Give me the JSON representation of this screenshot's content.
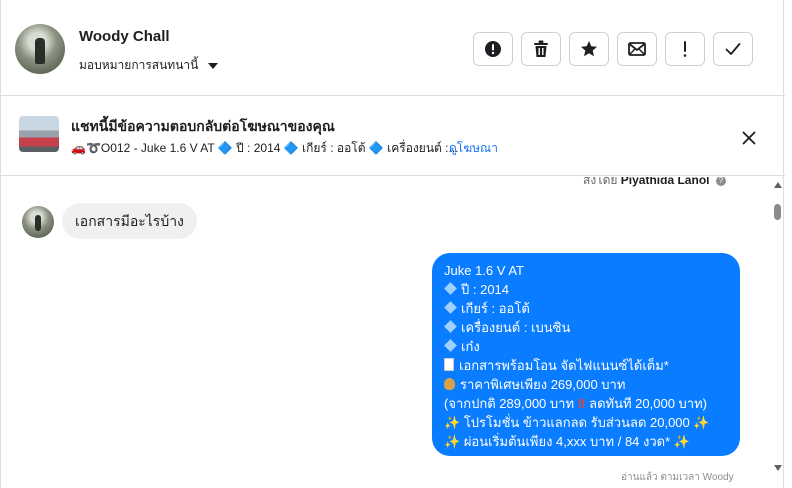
{
  "header": {
    "name": "Woody Chall",
    "assign_label": "มอบหมายการสนทนานี้",
    "actions": [
      {
        "icon": "alert-circle-icon",
        "name": "mark-spam-button"
      },
      {
        "icon": "trash-icon",
        "name": "delete-button"
      },
      {
        "icon": "star-icon",
        "name": "star-button"
      },
      {
        "icon": "envelope-icon",
        "name": "mark-unread-button"
      },
      {
        "icon": "exclamation-icon",
        "name": "follow-up-button"
      },
      {
        "icon": "check-icon",
        "name": "mark-done-button"
      }
    ]
  },
  "banner": {
    "title": "แชทนี้มีข้อความตอบกลับต่อโฆษณาของคุณ",
    "subtitle": "🚗➰O012 - Juke 1.6 V AT 🔷 ปี : 2014 🔷 เกียร์ : ออโต้ 🔷 เครื่องยนต์ :...",
    "link": "ดูโฆษณา"
  },
  "chat": {
    "sent_by_prefix": "ส่งโดย",
    "sent_by_name": "Piyathida Lanol",
    "incoming_message": "เอกสารมีอะไรบ้าง",
    "outgoing_lines": {
      "l1": "Juke 1.6 V AT",
      "l2": "ปี : 2014",
      "l3": "เกียร์ : ออโต้",
      "l4": "เครื่องยนต์ : เบนซิน",
      "l5": "เก๋ง",
      "l6": "เอกสารพร้อมโอน จัดไฟแนนซ์ได้เต็ม*",
      "l7": "ราคาพิเศษเพียง 269,000 บาท",
      "l8a": "(จากปกติ 289,000 บาท",
      "l8b": "ลดทันที 20,000 บาท)",
      "l9": "โปรโมชั่น ข้าวแลกลด รับส่วนลด 20,000",
      "l10": "ผ่อนเริ่มต้นเพียง 4,xxx บาท / 84 งวด*"
    },
    "read_receipt": "อ่านแล้ว ตามเวลา Woody"
  },
  "colors": {
    "accent": "#1877f2",
    "outgoing_bubble": "#0a7cff",
    "incoming_bubble": "#f0f0f0"
  }
}
